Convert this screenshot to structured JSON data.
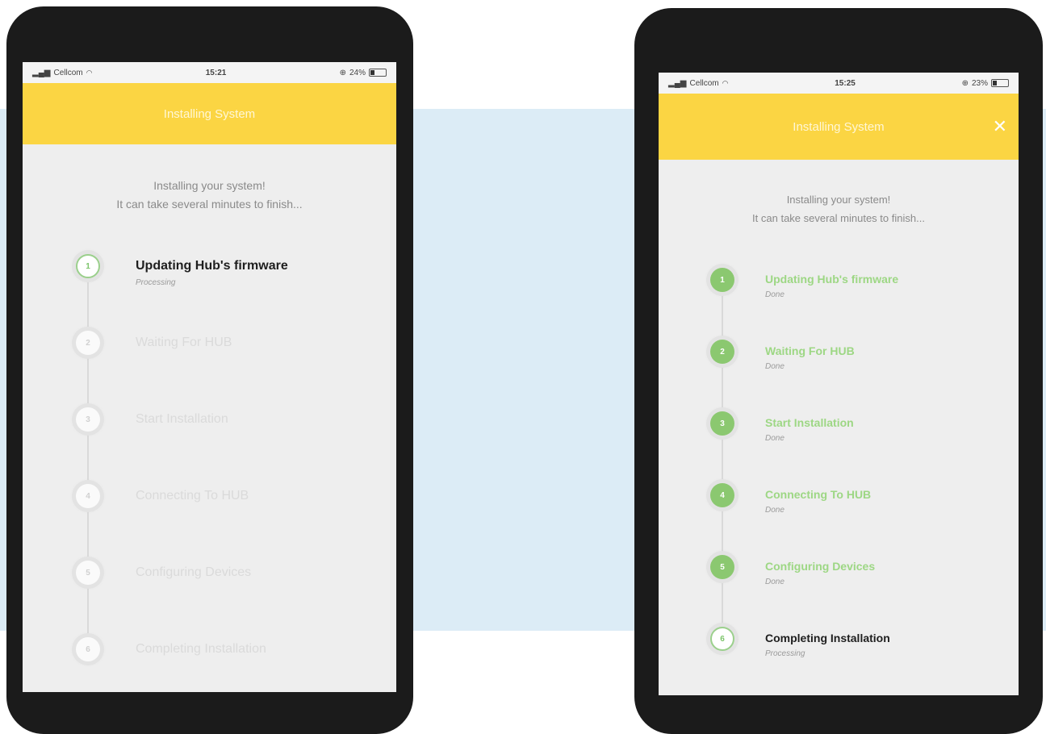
{
  "left": {
    "status_bar": {
      "carrier": "Cellcom",
      "time": "15:21",
      "battery": "24%"
    },
    "header": {
      "title": "Installing System"
    },
    "intro": {
      "line1": "Installing your system!",
      "line2": "It can take several minutes to finish..."
    },
    "steps": [
      {
        "number": "1",
        "label": "Updating Hub's firmware",
        "status": "Processing",
        "state": "active"
      },
      {
        "number": "2",
        "label": "Waiting For HUB",
        "status": "",
        "state": "pending"
      },
      {
        "number": "3",
        "label": "Start Installation",
        "status": "",
        "state": "pending"
      },
      {
        "number": "4",
        "label": "Connecting To HUB",
        "status": "",
        "state": "pending"
      },
      {
        "number": "5",
        "label": "Configuring Devices",
        "status": "",
        "state": "pending"
      },
      {
        "number": "6",
        "label": "Completing Installation",
        "status": "",
        "state": "pending"
      }
    ]
  },
  "right": {
    "status_bar": {
      "carrier": "Cellcom",
      "time": "15:25",
      "battery": "23%"
    },
    "header": {
      "title": "Installing System",
      "close_label": "✕"
    },
    "intro": {
      "line1": "Installing your system!",
      "line2": "It can take several minutes to finish..."
    },
    "steps": [
      {
        "number": "1",
        "label": "Updating Hub's firmware",
        "status": "Done",
        "state": "done"
      },
      {
        "number": "2",
        "label": "Waiting For HUB",
        "status": "Done",
        "state": "done"
      },
      {
        "number": "3",
        "label": "Start Installation",
        "status": "Done",
        "state": "done"
      },
      {
        "number": "4",
        "label": "Connecting To HUB",
        "status": "Done",
        "state": "done"
      },
      {
        "number": "5",
        "label": "Configuring Devices",
        "status": "Done",
        "state": "done"
      },
      {
        "number": "6",
        "label": "Completing Installation",
        "status": "Processing",
        "state": "active"
      }
    ]
  },
  "colors": {
    "header_yellow": "#fbd543",
    "done_green": "#8bc870",
    "backdrop_blue": "#dcecf6",
    "phone_frame": "#1b1b1b"
  }
}
